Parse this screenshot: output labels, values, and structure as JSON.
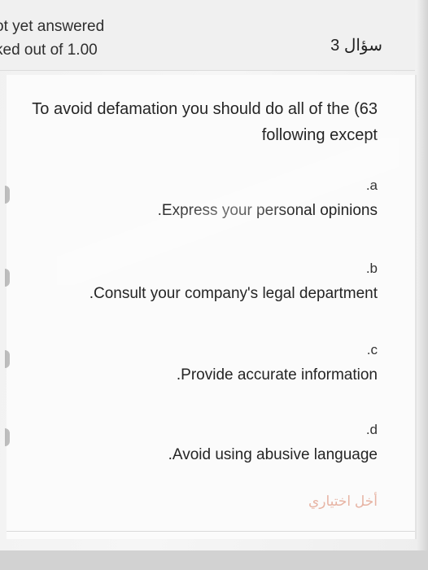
{
  "question_info": {
    "status": "ot yet answered",
    "marks": "ked out of 1.00"
  },
  "question_label": "سؤال 3",
  "question": {
    "text": "To avoid defamation you should do all of the (63 following except"
  },
  "options": [
    {
      "letter": ".a",
      "text": ".Express your personal opinions"
    },
    {
      "letter": ".b",
      "text": ".Consult your company's legal department"
    },
    {
      "letter": ".c",
      "text": ".Provide accurate information"
    },
    {
      "letter": ".d",
      "text": ".Avoid using abusive language"
    }
  ],
  "clear_choice_label": "أخل اختياري",
  "colors": {
    "clear_link": "#e7b4a4",
    "text": "#252525"
  }
}
